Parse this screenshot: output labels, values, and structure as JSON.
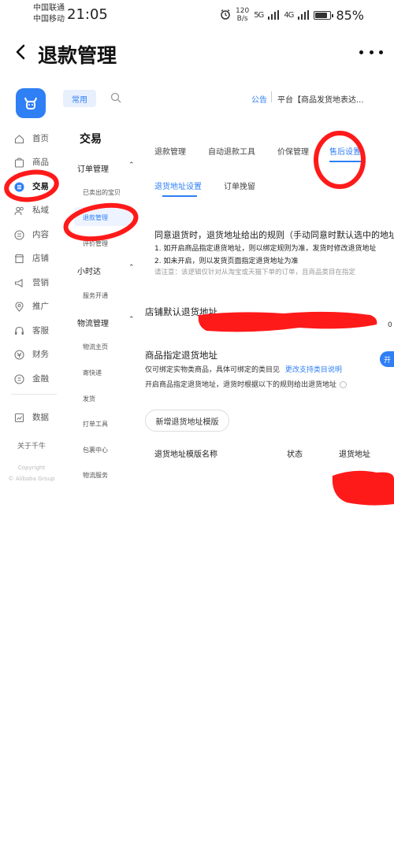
{
  "status_bar": {
    "carrier_1": "中国联通",
    "carrier_2": "中国移动",
    "time": "21:05",
    "speed_value": "120",
    "speed_unit": "B/s",
    "signal_1": "5G",
    "signal_2": "4G",
    "battery_percent": "85%",
    "battery_level": 0.85
  },
  "title_bar": {
    "title": "退款管理"
  },
  "header": {
    "tab_common": "常用",
    "notice_label": "公告",
    "notice_text": "平台【商品发货地表达..."
  },
  "rail": {
    "items": [
      {
        "label": "首页",
        "icon": "home-icon"
      },
      {
        "label": "商品",
        "icon": "goods-icon"
      },
      {
        "label": "交易",
        "icon": "trade-icon",
        "active": true
      },
      {
        "label": "私域",
        "icon": "people-icon"
      },
      {
        "label": "内容",
        "icon": "content-icon"
      },
      {
        "label": "店铺",
        "icon": "store-icon"
      },
      {
        "label": "营销",
        "icon": "megaphone-icon"
      },
      {
        "label": "推广",
        "icon": "location-icon"
      },
      {
        "label": "客服",
        "icon": "headset-icon"
      },
      {
        "label": "财务",
        "icon": "finance-icon"
      },
      {
        "label": "金融",
        "icon": "money-icon"
      },
      {
        "label": "数据",
        "icon": "chart-icon"
      }
    ],
    "about": "关于千牛",
    "copyright_1": "Copyright",
    "copyright_2": "© Alibaba Group"
  },
  "subnav": {
    "title": "交易",
    "group_orders": "订单管理",
    "sold_items": "已卖出的宝贝",
    "refund_mgmt": "退款管理",
    "review_mgmt": "评价管理",
    "group_hour": "小时达",
    "service_open": "服务开通",
    "group_logistics": "物流管理",
    "logistics_home": "物流主页",
    "send_express": "寄快递",
    "ship": "发货",
    "print_tools": "打单工具",
    "package_center": "包裹中心",
    "logistics_service": "物流服务"
  },
  "main": {
    "tabs": [
      "退款管理",
      "自动退款工具",
      "价保管理",
      "售后设置"
    ],
    "active_tab": 3,
    "sub_tabs": [
      "退货地址设置",
      "订单挽留"
    ],
    "active_sub_tab": 0,
    "rule_title": "同意退货时，退货地址给出的规则（手动同意时默认选中的地址",
    "rule_1": "1. 如开启商品指定退货地址，则以绑定规则为准，发货时修改退货地址",
    "rule_2": "2. 如未开启，则以发货页面指定退货地址为准",
    "rule_note": "请注意：该逻辑仅针对从淘宝或天猫下单的订单，且商品类目在指定",
    "store_default_title": "店铺默认退货地址",
    "store_default_suffix": "0",
    "specified_title": "商品指定退货地址",
    "specified_desc": "仅可绑定实物类商品，具体可绑定的类目见",
    "specified_link": "更改支持类目说明",
    "specified_toggle_desc": "开启商品指定退货地址，退货时根据以下的规则给出退货地址",
    "toggle_label": "开",
    "add_template": "新增退货地址模版",
    "table_headers": [
      "退货地址模版名称",
      "状态",
      "退货地址"
    ],
    "row_tail": "..."
  },
  "colors": {
    "accent": "#2f7ff5",
    "annotation_red": "#ff1a1a",
    "logo_bg": "#2f7ff5"
  }
}
